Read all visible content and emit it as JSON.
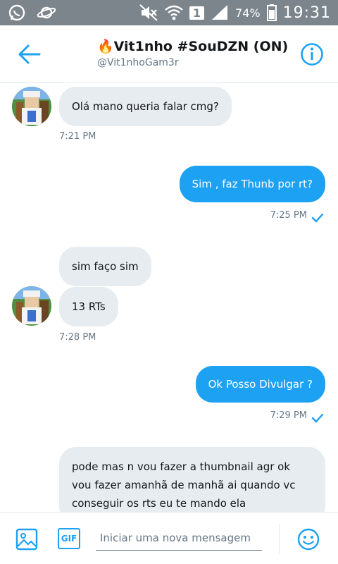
{
  "statusbar": {
    "battery": "74%",
    "sim_slot": "1",
    "clock": "19:31"
  },
  "header": {
    "title": "🔥Vit1nho #SouDZN (ON)",
    "handle": "@Vit1nhoGam3r"
  },
  "messages": [
    {
      "direction": "in",
      "text": "Olá mano queria falar cmg?",
      "time": "7:21 PM"
    },
    {
      "direction": "out",
      "text": "Sim , faz Thunb por rt?",
      "time": "7:25 PM"
    },
    {
      "direction": "in",
      "text": "sim faço sim"
    },
    {
      "direction": "in",
      "text": "13 RTs",
      "time": "7:28 PM"
    },
    {
      "direction": "out",
      "text": "Ok Posso Divulgar ?",
      "time": "7:29 PM"
    },
    {
      "direction": "in",
      "text": "pode mas n vou fazer a thumbnail agr ok vou fazer amanhã de manhã ai quando vc conseguir os rts eu te mando ela"
    }
  ],
  "compose": {
    "gif_label": "GIF",
    "placeholder": "Iniciar uma nova mensagem"
  },
  "colors": {
    "accent": "#1da1f2",
    "incoming_bubble": "#e6ecf0",
    "statusbar": "#7d858c"
  },
  "icons": [
    "whatsapp-icon",
    "saturn-icon",
    "mute-icon",
    "wifi-icon",
    "signal-icon",
    "battery-icon",
    "back-arrow-icon",
    "info-icon",
    "image-icon",
    "gif-icon",
    "emoji-icon",
    "read-check-icon"
  ]
}
